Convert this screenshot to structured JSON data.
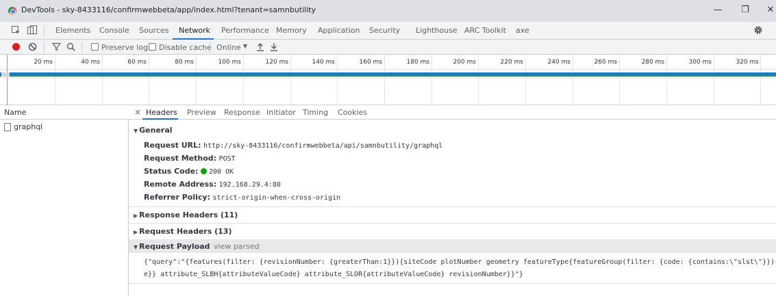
{
  "window": {
    "title": "DevTools - sky-8433116/confirmwebbeta/app/index.html?tenant=samnbutility",
    "min": "—",
    "restore": "❐",
    "close": "✕"
  },
  "tabs": [
    "Elements",
    "Console",
    "Sources",
    "Network",
    "Performance",
    "Memory",
    "Application",
    "Security",
    "Lighthouse",
    "ARC Toolkit",
    "axe"
  ],
  "active_tab": "Network",
  "toolbar": {
    "preserve_log": "Preserve log",
    "disable_cache": "Disable cache",
    "throttle": "Online"
  },
  "timeline": {
    "ticks": [
      "20 ms",
      "40 ms",
      "60 ms",
      "80 ms",
      "100 ms",
      "120 ms",
      "140 ms",
      "160 ms",
      "180 ms",
      "200 ms",
      "220 ms",
      "240 ms",
      "260 ms",
      "280 ms",
      "300 ms",
      "320 ms"
    ]
  },
  "requests": {
    "name_header": "Name",
    "items": [
      "graphql"
    ]
  },
  "details": {
    "close": "×",
    "tabs": [
      "Headers",
      "Preview",
      "Response",
      "Initiator",
      "Timing",
      "Cookies"
    ],
    "active_tab": "Headers",
    "general": {
      "title": "General",
      "request_url_label": "Request URL:",
      "request_url": "http://sky-8433116/confirmwebbeta/api/samnbutility/graphql",
      "request_method_label": "Request Method:",
      "request_method": "POST",
      "status_code_label": "Status Code:",
      "status_code": "200 OK",
      "remote_address_label": "Remote Address:",
      "remote_address": "192.168.29.4:80",
      "referrer_policy_label": "Referrer Policy:",
      "referrer_policy": "strict-origin-when-cross-origin"
    },
    "response_headers": "Response Headers (11)",
    "request_headers": "Request Headers (13)",
    "payload": {
      "title": "Request Payload",
      "view_parsed": "view parsed",
      "line1": "{\"query\":\"{features(filter: {revisionNumber: {greaterThan:1}}){siteCode plotNumber geometry featureType{featureGroup(filter: {code: {contains:\\\"slst\\\"}}){cod",
      "line2": "e}} attribute_SLBH{attributeValueCode} attribute_SLOR{attributeValueCode} revisionNumber}}\"}"
    }
  },
  "colors": {
    "accent": "#1a73e8",
    "record": "#e21b1b",
    "status_ok": "#00aa00"
  }
}
